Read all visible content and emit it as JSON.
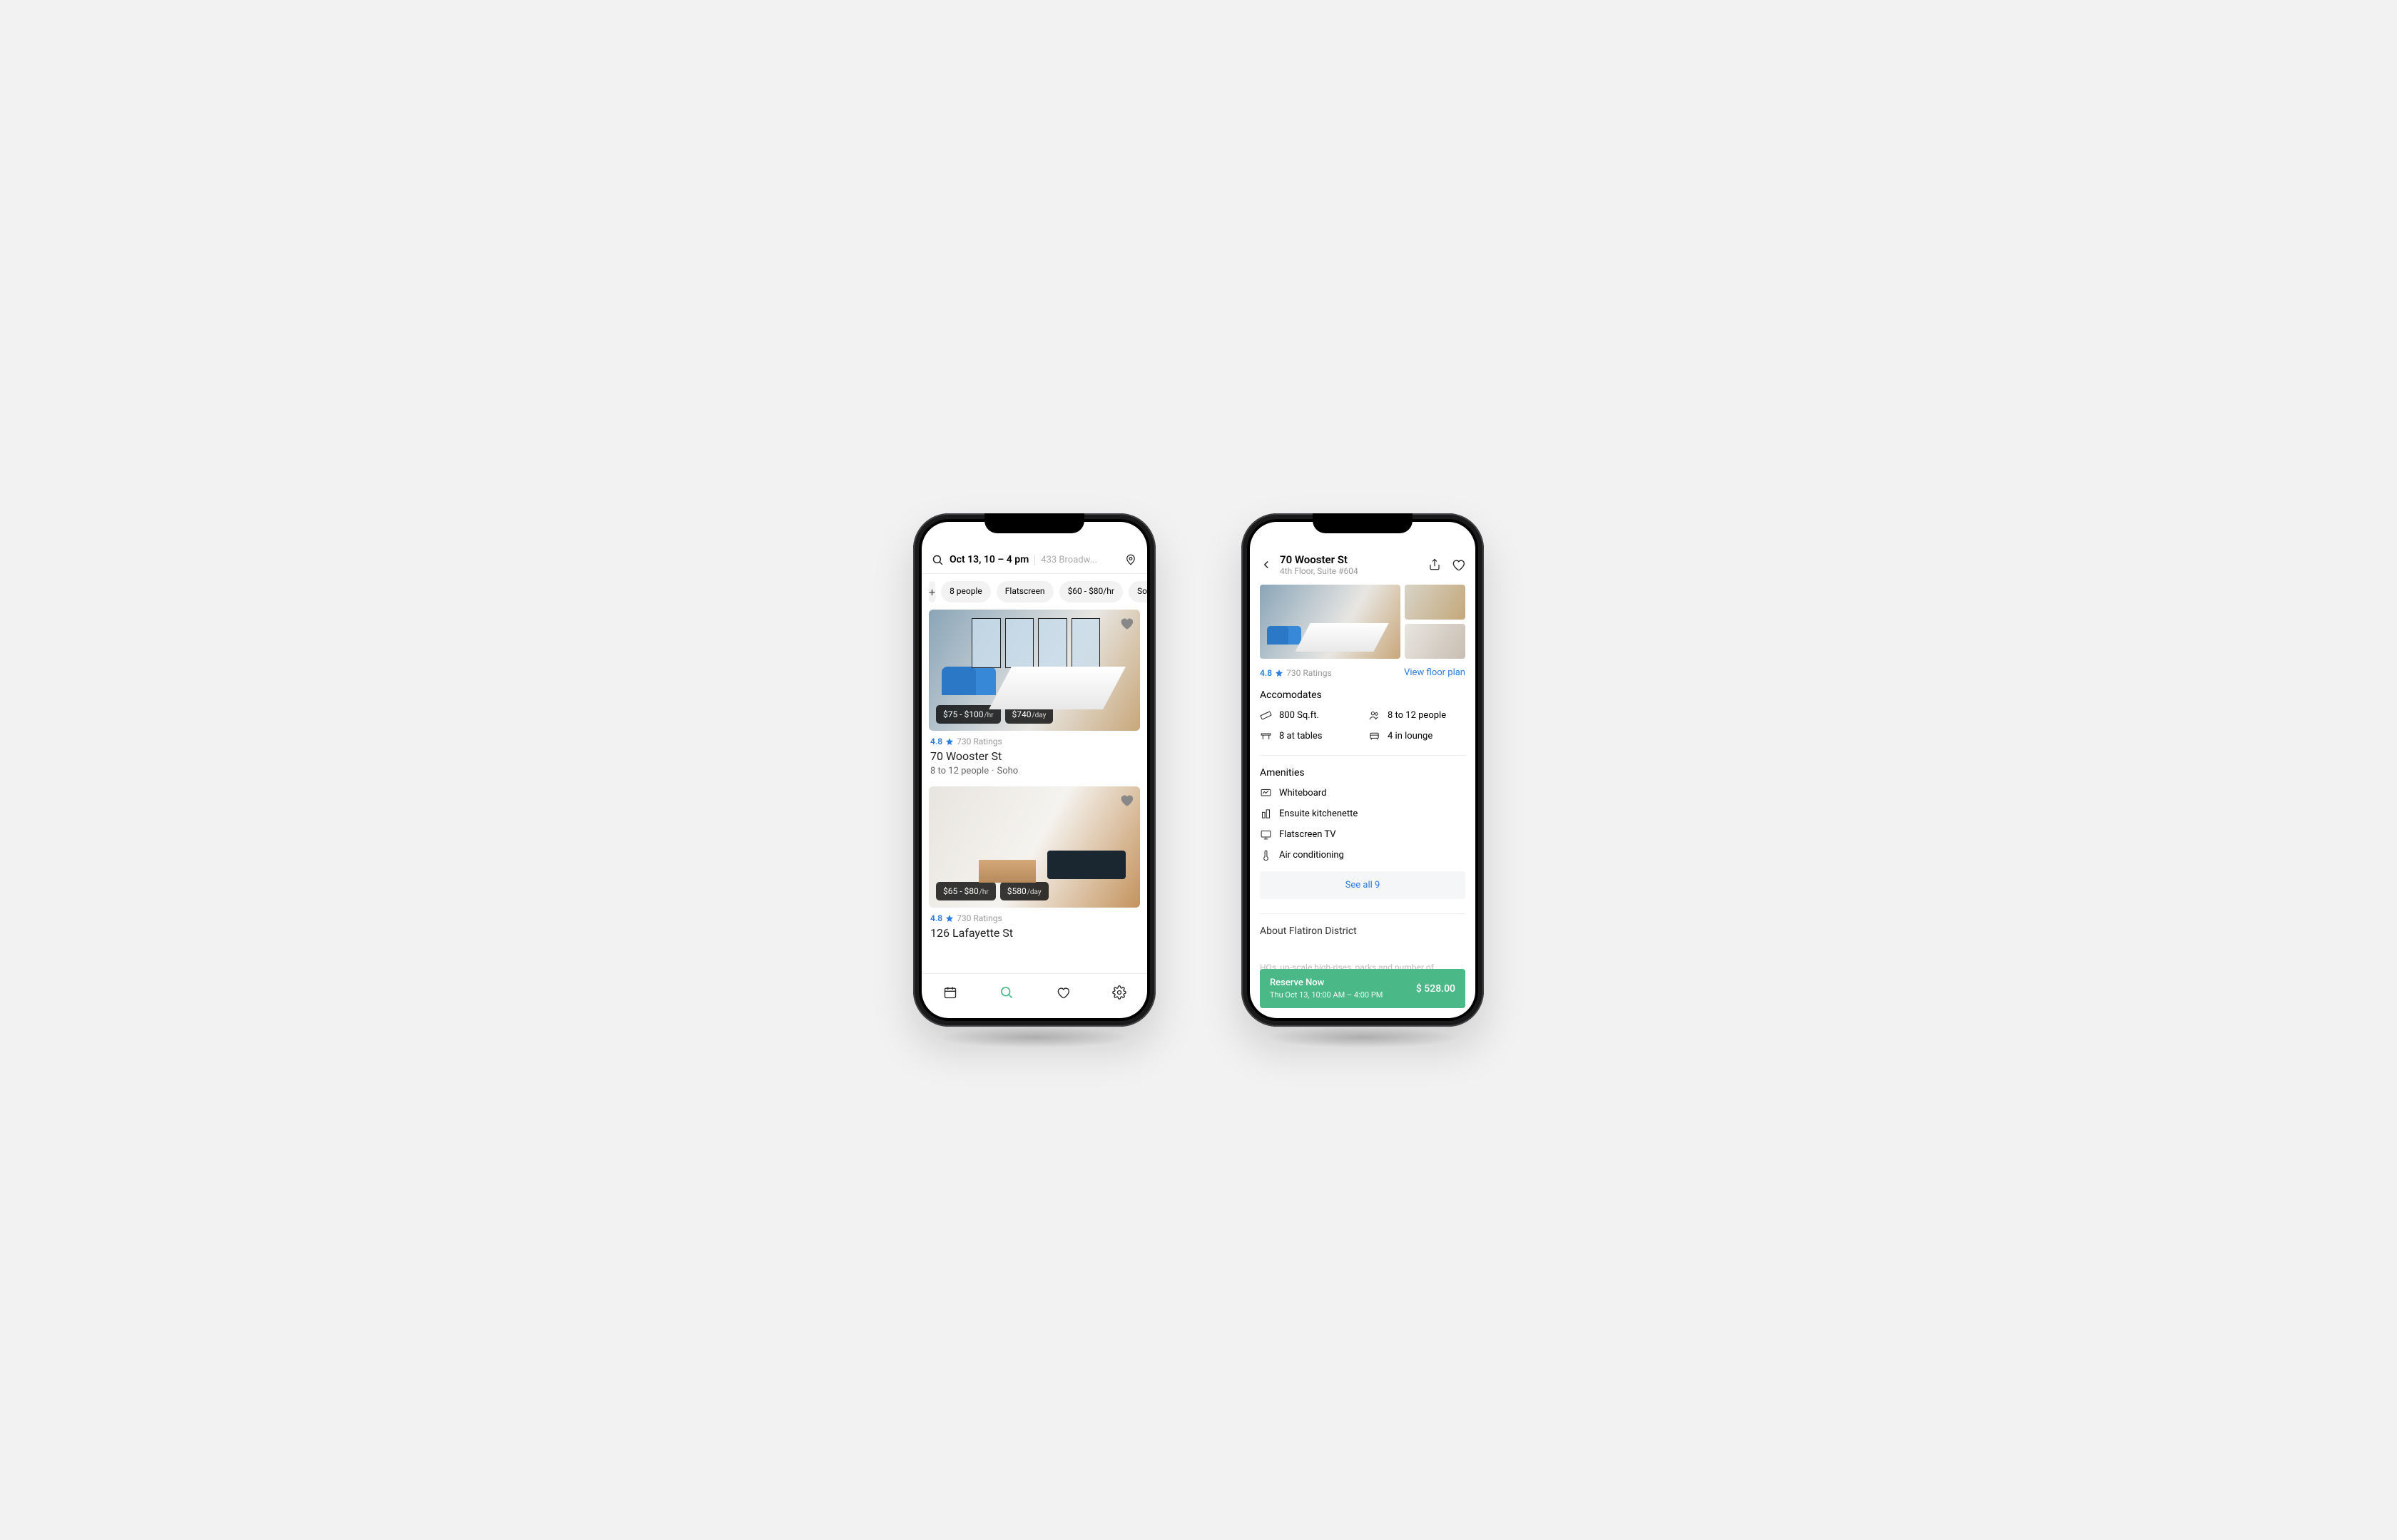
{
  "colors": {
    "accent": "#2b7de0",
    "cta": "#4ab887"
  },
  "search": {
    "query": "Oct 13, 10 – 4 pm",
    "location_truncated": "433 Broadw...",
    "filters": {
      "people": "8 people",
      "screen": "Flatscreen",
      "price": "$60 - $80/hr",
      "more_truncated": "So"
    }
  },
  "listings": [
    {
      "price_hr": "$75 - $100",
      "price_hr_unit": "/hr",
      "price_day": "$740",
      "price_day_unit": "/day",
      "rating": "4.8",
      "rating_count": "730 Ratings",
      "title": "70 Wooster St",
      "capacity": "8 to 12 people",
      "neighborhood": "Soho"
    },
    {
      "price_hr": "$65 - $80",
      "price_hr_unit": "/hr",
      "price_day": "$580",
      "price_day_unit": "/day",
      "rating": "4.8",
      "rating_count": "730 Ratings",
      "title": "126 Lafayette St"
    }
  ],
  "detail": {
    "title": "70 Wooster St",
    "subtitle": "4th Floor, Suite #604",
    "rating": "4.8",
    "rating_count": "730 Ratings",
    "floorplan_link": "View floor plan",
    "accommodates_title": "Accomodates",
    "accommodates": {
      "sqft": "800 Sq.ft.",
      "people": "8 to 12 people",
      "tables": "8 at tables",
      "lounge": "4 in lounge"
    },
    "amenities_title": "Amenities",
    "amenities": [
      "Whiteboard",
      "Ensuite kitchenette",
      "Flatscreen TV",
      "Air conditioning"
    ],
    "see_all": "See all 9",
    "about_title": "About Flatiron District",
    "about_text_truncated": "HQs, up-scale high-rises, parks and number of",
    "reserve": {
      "title": "Reserve Now",
      "sub": "Thu Oct 13, 10:00 AM – 4:00 PM",
      "price": "$ 528.00"
    }
  }
}
